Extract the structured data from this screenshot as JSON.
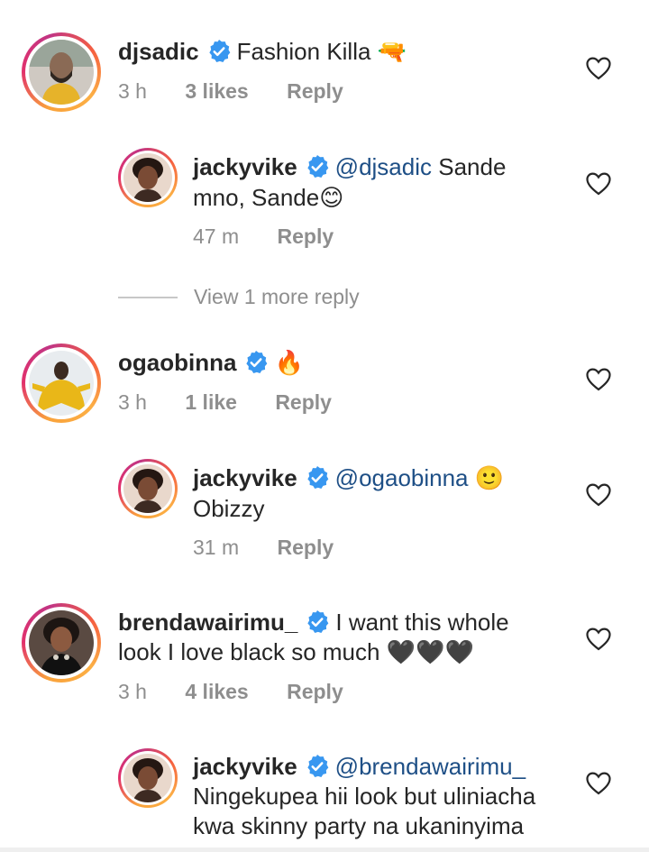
{
  "comments": [
    {
      "username": "djsadic",
      "text": "Fashion Killa 🔫",
      "time": "3 h",
      "likes": "3 likes",
      "reply_label": "Reply",
      "avatar_color": "#6b5a4a"
    },
    {
      "username": "jackyvike",
      "mention": "@djsadic",
      "text_line1": " Sande",
      "text_line2": "mno, Sande😊",
      "time": "47 m",
      "reply_label": "Reply",
      "avatar_color": "#4a3428"
    },
    {
      "username": "ogaobinna",
      "text": "🔥",
      "time": "3 h",
      "likes": "1 like",
      "reply_label": "Reply",
      "avatar_color": "#d9a21b"
    },
    {
      "username": "jackyvike",
      "mention": "@ogaobinna",
      "text_line1": " 🙂",
      "text_line2": "Obizzy",
      "time": "31 m",
      "reply_label": "Reply",
      "avatar_color": "#4a3428"
    },
    {
      "username": "brendawairimu_",
      "text_line1": "I want this whole",
      "text_line2": "look I love black so much 🖤🖤🖤",
      "time": "3 h",
      "likes": "4 likes",
      "reply_label": "Reply",
      "avatar_color": "#2b2b2b"
    },
    {
      "username": "jackyvike",
      "mention": "@brendawairimu_",
      "text_line1": "Ningekupea hii look but uliniacha",
      "text_line2": "kwa skinny party na ukaninyima",
      "avatar_color": "#4a3428"
    }
  ],
  "view_more": "View 1 more reply",
  "colors": {
    "mention": "#1e4f86",
    "verified": "#3897f0",
    "meta": "#8e8e8e",
    "text": "#262626"
  }
}
